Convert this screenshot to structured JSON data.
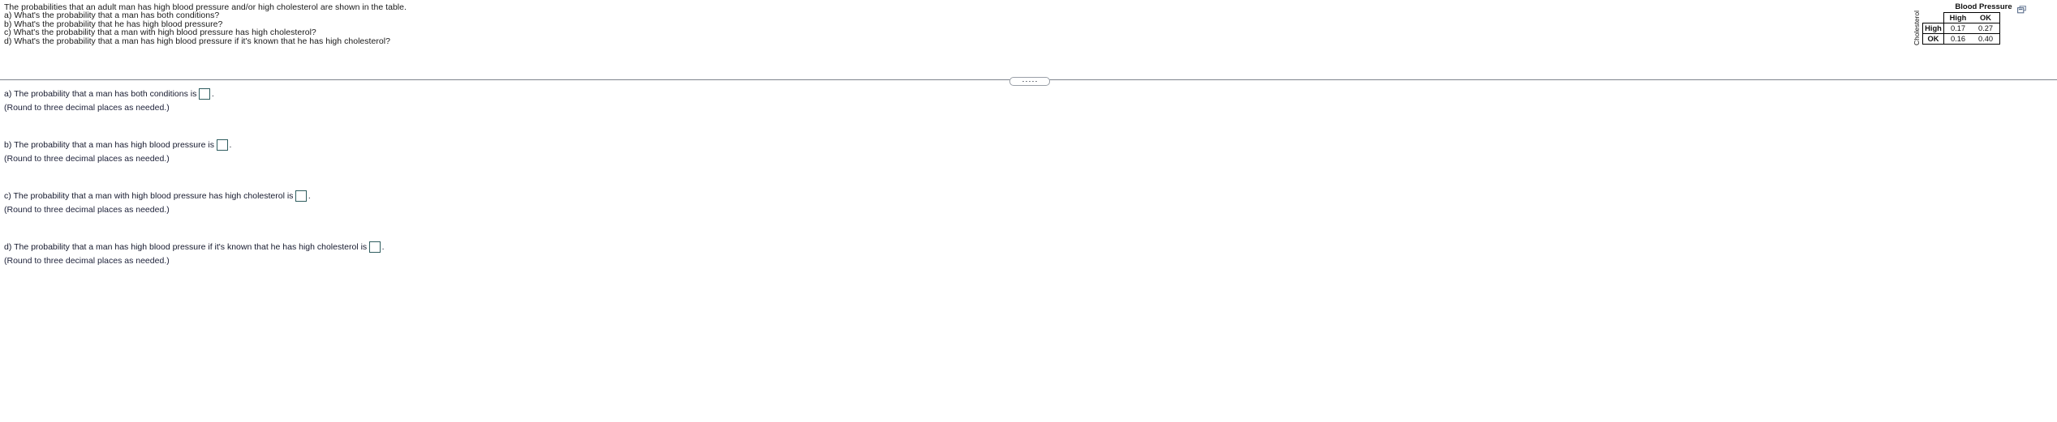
{
  "problem": {
    "lines": [
      "The probabilities that an adult man has high blood pressure and/or high cholesterol are shown in the table.",
      "a) What's the probability that a man has both conditions?",
      "b) What's the probability that he has high blood pressure?",
      "c) What's the probability that a man with high blood pressure has high cholesterol?",
      "d) What's the probability that a man has high blood pressure if it's known that he has high cholesterol?"
    ]
  },
  "figure": {
    "column_group_title": "Blood Pressure",
    "row_group_title": "Cholesterol",
    "copy_icon": "copy-icon",
    "column_headers": [
      "High",
      "OK"
    ],
    "row_headers": [
      "High",
      "OK"
    ],
    "cells": [
      [
        "0.17",
        "0.27"
      ],
      [
        "0.16",
        "0.40"
      ]
    ]
  },
  "divider": {
    "handle_dots": 5
  },
  "answers": {
    "round_note": "(Round to three decimal places as needed.)",
    "items": [
      {
        "prefix": "a) The probability that a man has both conditions is",
        "suffix": ".",
        "value": "",
        "placeholder": ""
      },
      {
        "prefix": "b) The probability that a man has high blood pressure is",
        "suffix": ".",
        "value": "",
        "placeholder": ""
      },
      {
        "prefix": "c) The probability that a man with high blood pressure has high cholesterol is",
        "suffix": ".",
        "value": "",
        "placeholder": ""
      },
      {
        "prefix": "d) The probability that a man has high blood pressure if it's known that he has high cholesterol is",
        "suffix": ".",
        "value": "",
        "placeholder": ""
      }
    ]
  }
}
